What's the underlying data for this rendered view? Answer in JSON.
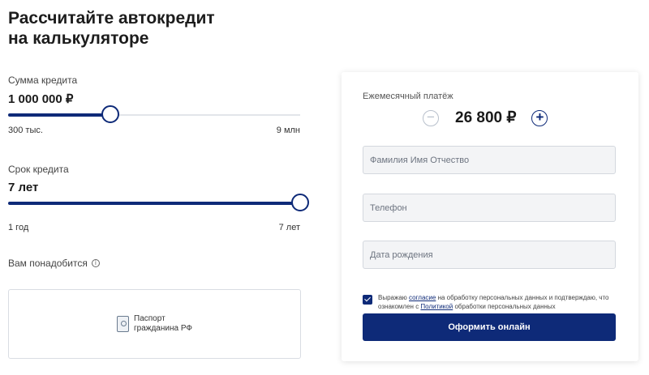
{
  "title_line1": "Рассчитайте автокредит",
  "title_line2": "на калькуляторе",
  "amount": {
    "label": "Сумма кредита",
    "value": "1 000 000 ₽",
    "min_label": "300 тыс.",
    "max_label": "9 млн",
    "slider_fraction": 0.35
  },
  "term": {
    "label": "Срок кредита",
    "value": "7 лет",
    "min_label": "1 год",
    "max_label": "7 лет",
    "slider_fraction": 1.0
  },
  "need": {
    "label": "Вам понадобится",
    "info_icon": "i",
    "doc_line1": "Паспорт",
    "doc_line2": "гражданина РФ"
  },
  "panel": {
    "monthly_label": "Ежемесячный платёж",
    "minus": "−",
    "plus": "+",
    "amount": "26 800 ₽",
    "fio_placeholder": "Фамилия Имя Отчество",
    "phone_placeholder": "Телефон",
    "birth_placeholder": "Дата рождения",
    "consent_part1": "Выражаю ",
    "consent_link1": "согласие",
    "consent_part2": " на обработку персональных данных и подтверждаю, что ознакомлен с ",
    "consent_link2": "Политикой",
    "consent_part3": " обработки персональных данных",
    "submit_label": "Оформить онлайн"
  },
  "colors": {
    "accent": "#0e2a78",
    "track": "#e2e5ea",
    "field_bg": "#f3f4f6"
  }
}
